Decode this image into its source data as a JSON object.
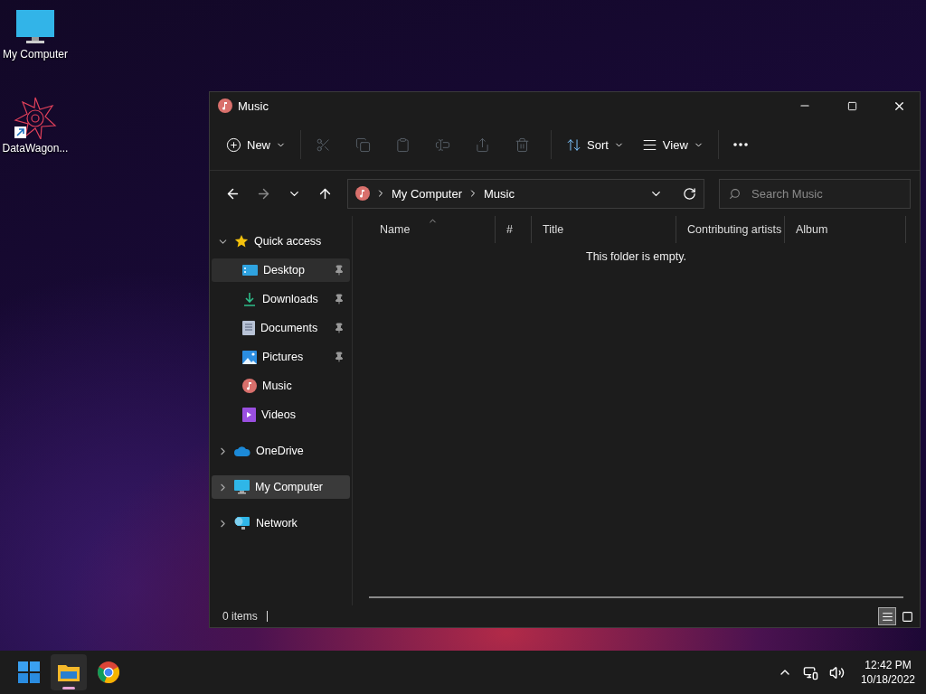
{
  "desktop_icons": [
    {
      "kind": "computer",
      "label": "My Computer"
    },
    {
      "kind": "shortcut",
      "label": "DataWagon..."
    }
  ],
  "window": {
    "title": "Music",
    "toolbar": [
      {
        "kind": "new",
        "label": "New",
        "disabled": false
      },
      {
        "kind": "cut",
        "disabled": true
      },
      {
        "kind": "copy",
        "disabled": true
      },
      {
        "kind": "paste",
        "disabled": true
      },
      {
        "kind": "rename",
        "disabled": true
      },
      {
        "kind": "share",
        "disabled": true
      },
      {
        "kind": "delete",
        "disabled": true
      },
      {
        "kind": "sort",
        "label": "Sort",
        "disabled": false
      },
      {
        "kind": "view",
        "label": "View",
        "disabled": false
      },
      {
        "kind": "more"
      }
    ],
    "nav": [
      {
        "kind": "back",
        "disabled": false
      },
      {
        "kind": "forward",
        "disabled": true
      },
      {
        "kind": "recent",
        "disabled": false
      },
      {
        "kind": "up",
        "disabled": false
      }
    ],
    "address": {
      "crumbs": [
        "My Computer",
        "Music"
      ]
    },
    "search": {
      "placeholder": "Search Music"
    },
    "sidebar": [
      {
        "kind": "star",
        "label": "Quick access",
        "expanded": true,
        "selected": false,
        "hovered": false,
        "children": [
          {
            "kind": "desktop",
            "label": "Desktop",
            "pinned": true,
            "selected": false,
            "hovered": true
          },
          {
            "kind": "downloads",
            "label": "Downloads",
            "pinned": true,
            "selected": false,
            "hovered": false
          },
          {
            "kind": "documents",
            "label": "Documents",
            "pinned": true,
            "selected": false,
            "hovered": false
          },
          {
            "kind": "pictures",
            "label": "Pictures",
            "pinned": true,
            "selected": false,
            "hovered": false
          },
          {
            "kind": "music",
            "label": "Music",
            "pinned": false,
            "selected": false,
            "hovered": false
          },
          {
            "kind": "videos",
            "label": "Videos",
            "pinned": false,
            "selected": false,
            "hovered": false
          }
        ]
      },
      {
        "kind": "cloud",
        "label": "OneDrive",
        "expanded": false,
        "selected": false,
        "hovered": false
      },
      {
        "kind": "computer",
        "label": "My Computer",
        "expanded": false,
        "selected": true,
        "hovered": false
      },
      {
        "kind": "network",
        "label": "Network",
        "expanded": false,
        "selected": false,
        "hovered": false
      }
    ],
    "columns": [
      {
        "label": "Name",
        "sorted": true
      },
      {
        "label": "#",
        "sorted": false
      },
      {
        "label": "Title",
        "sorted": false
      },
      {
        "label": "Contributing artists",
        "sorted": false
      },
      {
        "label": "Album",
        "sorted": false
      }
    ],
    "empty_message": "This folder is empty.",
    "status": {
      "count": "0 items",
      "views": [
        {
          "kind": "details",
          "selected": true
        },
        {
          "kind": "tiles",
          "selected": false
        }
      ]
    }
  },
  "taskbar": {
    "apps": [
      {
        "kind": "start",
        "active": false
      },
      {
        "kind": "explorer",
        "active": true
      },
      {
        "kind": "browser",
        "active": false
      }
    ],
    "time": "12:42 PM",
    "date": "10/18/2022"
  }
}
